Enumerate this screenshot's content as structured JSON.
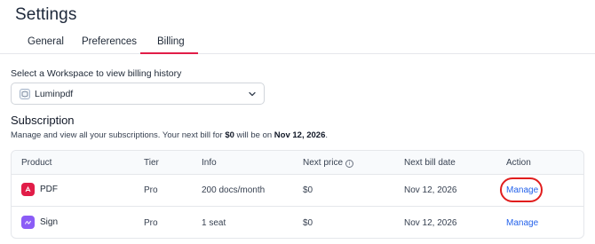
{
  "page": {
    "title": "Settings"
  },
  "tabs": [
    {
      "label": "General"
    },
    {
      "label": "Preferences"
    },
    {
      "label": "Billing"
    }
  ],
  "workspace": {
    "label": "Select a Workspace to view billing history",
    "selected": "Luminpdf"
  },
  "subscription": {
    "title": "Subscription",
    "desc_prefix": "Manage and view all your subscriptions. Your next bill for ",
    "amount": "$0",
    "desc_middle": " will be on ",
    "date": "Nov 12, 2026",
    "desc_suffix": "."
  },
  "table": {
    "headers": {
      "product": "Product",
      "tier": "Tier",
      "info": "Info",
      "next_price": "Next price",
      "next_bill_date": "Next bill date",
      "action": "Action"
    },
    "rows": [
      {
        "product": "PDF",
        "tier": "Pro",
        "info": "200 docs/month",
        "next_price": "$0",
        "next_bill_date": "Nov 12, 2026",
        "action": "Manage",
        "icon": "pdf-icon",
        "icon_color": "#e11d48"
      },
      {
        "product": "Sign",
        "tier": "Pro",
        "info": "1 seat",
        "next_price": "$0",
        "next_bill_date": "Nov 12, 2026",
        "action": "Manage",
        "icon": "sign-icon",
        "icon_color": "#8b5cf6"
      }
    ]
  },
  "colors": {
    "accent": "#e11d48",
    "link": "#2563eb",
    "highlight": "#e11d1d"
  }
}
